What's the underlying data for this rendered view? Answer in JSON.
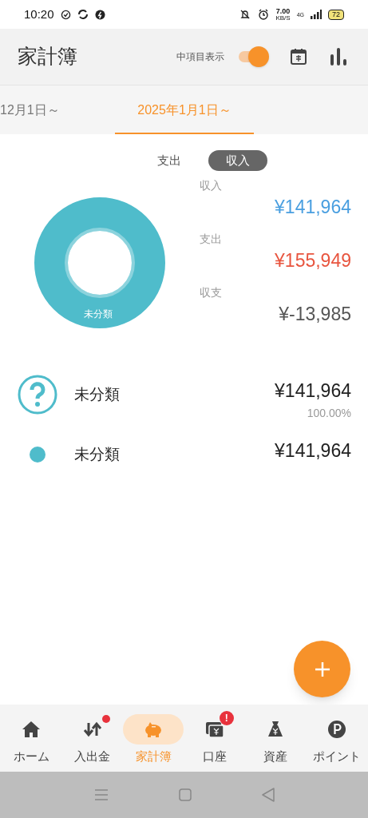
{
  "status_bar": {
    "time": "10:20",
    "speed": "7.00",
    "speed_unit": "KB/S",
    "network": "4G",
    "battery": "72"
  },
  "header": {
    "title": "家計簿",
    "toggle_label": "中項目表示",
    "toggle_on": true
  },
  "period_tabs": [
    {
      "label": "12月1日～",
      "selected": false
    },
    {
      "label": "2025年1月1日～",
      "selected": true
    }
  ],
  "type_switch": [
    {
      "label": "支出",
      "selected": false
    },
    {
      "label": "収入",
      "selected": true
    }
  ],
  "donut": {
    "label": "未分類",
    "color": "#4fbccb"
  },
  "summary": [
    {
      "label": "収入",
      "amount": "¥141,964",
      "kind": "income"
    },
    {
      "label": "支出",
      "amount": "¥155,949",
      "kind": "expense"
    },
    {
      "label": "収支",
      "amount": "¥-13,985",
      "kind": "balance"
    }
  ],
  "categories": [
    {
      "kind": "question",
      "name": "未分類",
      "amount": "¥141,964",
      "percent": "100.00%"
    },
    {
      "kind": "dot",
      "name": "未分類",
      "amount": "¥141,964",
      "color": "#4fbccb"
    }
  ],
  "bottom_nav": [
    {
      "label": "ホーム",
      "selected": false
    },
    {
      "label": "入出金",
      "selected": false,
      "badge": {
        "kind": "dot"
      }
    },
    {
      "label": "家計簿",
      "selected": true
    },
    {
      "label": "口座",
      "selected": false,
      "badge": {
        "kind": "alert",
        "text": "!"
      }
    },
    {
      "label": "資産",
      "selected": false
    },
    {
      "label": "ポイント",
      "selected": false
    }
  ]
}
